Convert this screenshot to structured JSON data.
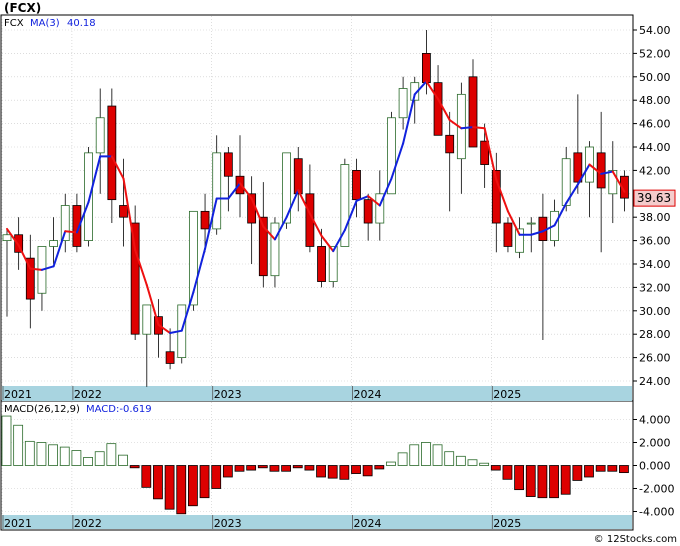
{
  "title": "(FCX)",
  "legend": {
    "symbol": "FCX",
    "ma_label": "MA(3)",
    "ma_value": "40.18"
  },
  "last_price": "39.63",
  "macd_header": {
    "label": "MACD(26,12,9)",
    "value_label": "MACD:-0.619"
  },
  "watermark": "© 12Stocks.com",
  "colors": {
    "up": "#000000",
    "down": "#dd0000",
    "ma_down": "#ee1111",
    "ma_up": "#1122dd",
    "axis_band": "#a8d4e0",
    "macd_pos_fill": "#ffffff",
    "macd_neg_fill": "#dd0000"
  },
  "chart_data": [
    {
      "type": "candlestick",
      "title": "(FCX)",
      "ylim": [
        23.5,
        56
      ],
      "y_ticks": [
        "24.00",
        "26.00",
        "28.00",
        "30.00",
        "32.00",
        "34.00",
        "36.00",
        "38.00",
        "40.00",
        "42.00",
        "44.00",
        "46.00",
        "48.00",
        "50.00",
        "52.00",
        "54.00"
      ],
      "x_labels": [
        {
          "label": "2021",
          "bar": 0
        },
        {
          "label": "2022",
          "bar": 6
        },
        {
          "label": "2023",
          "bar": 18
        },
        {
          "label": "2024",
          "bar": 30
        },
        {
          "label": "2025",
          "bar": 42
        }
      ],
      "ohlc": [
        [
          36,
          37,
          29.5,
          36.5
        ],
        [
          36.5,
          38,
          33.5,
          35
        ],
        [
          34.5,
          36.5,
          28.5,
          31
        ],
        [
          31.5,
          35,
          30,
          35.5
        ],
        [
          35.5,
          38,
          34,
          36
        ],
        [
          36,
          40,
          35,
          39
        ],
        [
          39,
          40,
          35,
          35.5
        ],
        [
          36,
          44,
          35.5,
          43.5
        ],
        [
          43.5,
          49,
          40,
          46.5
        ],
        [
          47.5,
          49,
          37.5,
          39.5
        ],
        [
          39,
          43,
          35.5,
          38
        ],
        [
          37.5,
          39,
          27.5,
          28
        ],
        [
          28,
          30,
          23.5,
          30.5
        ],
        [
          29.5,
          31,
          26,
          28
        ],
        [
          26.5,
          28.5,
          25,
          25.5
        ],
        [
          26,
          30,
          25.5,
          30.5
        ],
        [
          30.5,
          38,
          30,
          38.5
        ],
        [
          38.5,
          40,
          35,
          37
        ],
        [
          37,
          45,
          36.5,
          43.5
        ],
        [
          43.5,
          44,
          38.5,
          41.5
        ],
        [
          41.5,
          45,
          38,
          40
        ],
        [
          40,
          41.5,
          34,
          37.5
        ],
        [
          38,
          41,
          32,
          33
        ],
        [
          33,
          38,
          32,
          37.5
        ],
        [
          37.5,
          43.5,
          37,
          43.5
        ],
        [
          43,
          44,
          38.5,
          40
        ],
        [
          40,
          42.5,
          35,
          35.5
        ],
        [
          35.5,
          37,
          32,
          32.5
        ],
        [
          32.5,
          34,
          32,
          35.5
        ],
        [
          35.5,
          43,
          35.5,
          42.5
        ],
        [
          42,
          43,
          38,
          39.5
        ],
        [
          39.5,
          40,
          36,
          37.5
        ],
        [
          37.5,
          42,
          36,
          40
        ],
        [
          40,
          47,
          40,
          46.5
        ],
        [
          46.5,
          50,
          45.5,
          49
        ],
        [
          48,
          50,
          46,
          49.5
        ],
        [
          52,
          54,
          48.5,
          49.5
        ],
        [
          49.5,
          51,
          47.5,
          45
        ],
        [
          45,
          47,
          38.5,
          43.5
        ],
        [
          43,
          49.5,
          40,
          48.5
        ],
        [
          50,
          51.5,
          45.5,
          44
        ],
        [
          44.5,
          46,
          40.5,
          42.5
        ],
        [
          42,
          43.5,
          35,
          37.5
        ],
        [
          37.5,
          38,
          35,
          35.5
        ],
        [
          35,
          38,
          34.5,
          37
        ],
        [
          37.5,
          38,
          35,
          37.5
        ],
        [
          38,
          40,
          27.5,
          36
        ],
        [
          36,
          39.5,
          35.5,
          38.5
        ],
        [
          39,
          44,
          38.5,
          43
        ],
        [
          43.5,
          48.5,
          40,
          41
        ],
        [
          41,
          44.5,
          38,
          44
        ],
        [
          43.5,
          47,
          35,
          40.5
        ],
        [
          40,
          44.5,
          37.5,
          42
        ],
        [
          41.5,
          42,
          38.5,
          39.63
        ]
      ],
      "ma_series": [
        37,
        35.6,
        33.6,
        33.5,
        33.8,
        36.8,
        36.7,
        39.3,
        43.2,
        43.2,
        41.3,
        35.2,
        32.2,
        28.8,
        28.1,
        28.3,
        31.6,
        35.3,
        39.6,
        39.6,
        40.9,
        39.6,
        37.2,
        36.1,
        38,
        40.3,
        38.3,
        36.4,
        35.1,
        36.9,
        39.4,
        39.8,
        39,
        41.3,
        44.3,
        48.5,
        49.6,
        48.1,
        46.3,
        45.6,
        45.7,
        45.6,
        41.2,
        38.5,
        36.5,
        36.5,
        36.8,
        37.3,
        39.2,
        40.8,
        42.5,
        41.7,
        41.9,
        40.18
      ],
      "last_close": 39.63
    },
    {
      "type": "bar",
      "title": "MACD(26,12,9)",
      "ylim": [
        -4.4,
        4.7
      ],
      "y_ticks": [
        "-4.000",
        "-2.000",
        "0.000",
        "2.000",
        "4.000"
      ],
      "values": [
        4.3,
        3.5,
        2.1,
        2.0,
        1.8,
        1.6,
        1.3,
        0.7,
        1.2,
        1.9,
        0.9,
        -0.2,
        -1.9,
        -2.9,
        -3.8,
        -4.2,
        -3.5,
        -2.8,
        -2.0,
        -1.0,
        -0.5,
        -0.4,
        -0.2,
        -0.5,
        -0.5,
        -0.2,
        -0.4,
        -1.0,
        -1.1,
        -1.2,
        -0.7,
        -0.9,
        -0.3,
        0.3,
        1.1,
        1.8,
        2.0,
        1.8,
        1.2,
        0.8,
        0.5,
        0.2,
        -0.4,
        -1.2,
        -2.1,
        -2.7,
        -2.8,
        -2.8,
        -2.5,
        -1.3,
        -1.0,
        -0.5,
        -0.5,
        -0.619
      ]
    }
  ]
}
